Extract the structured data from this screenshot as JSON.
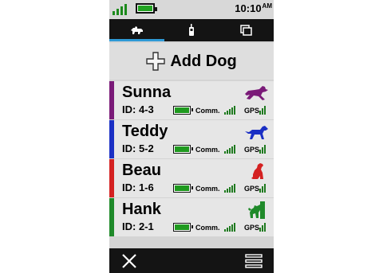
{
  "status": {
    "time": "10:10",
    "ampm": "AM",
    "signal_bars": 4,
    "battery_level": 1.0
  },
  "tabs": [
    {
      "icon": "dog-icon",
      "active": true
    },
    {
      "icon": "handheld-device-icon",
      "active": false
    },
    {
      "icon": "pages-icon",
      "active": false
    }
  ],
  "add_dog": {
    "label": "Add Dog",
    "icon": "plus-icon"
  },
  "dogs": [
    {
      "name": "Sunna",
      "id": "ID: 4-3",
      "color": "#7a1a78",
      "icon": "dog-running-icon",
      "comm_label": "Comm.",
      "gps_label": "GPS"
    },
    {
      "name": "Teddy",
      "id": "ID: 5-2",
      "color": "#1a2fc4",
      "icon": "dog-pointing-icon",
      "comm_label": "Comm.",
      "gps_label": "GPS"
    },
    {
      "name": "Beau",
      "id": "ID: 1-6",
      "color": "#d42121",
      "icon": "dog-sitting-icon",
      "comm_label": "Comm.",
      "gps_label": "GPS"
    },
    {
      "name": "Hank",
      "id": "ID: 2-1",
      "color": "#1f8a2a",
      "icon": "dog-treed-icon",
      "comm_label": "Comm.",
      "gps_label": "GPS"
    }
  ],
  "footer": {
    "close_icon": "close-icon",
    "menu_icon": "menu-icon"
  },
  "colors": {
    "accent": "#2f9ad6",
    "signal_green": "#1f7a1f",
    "battery_green": "#22a322"
  }
}
